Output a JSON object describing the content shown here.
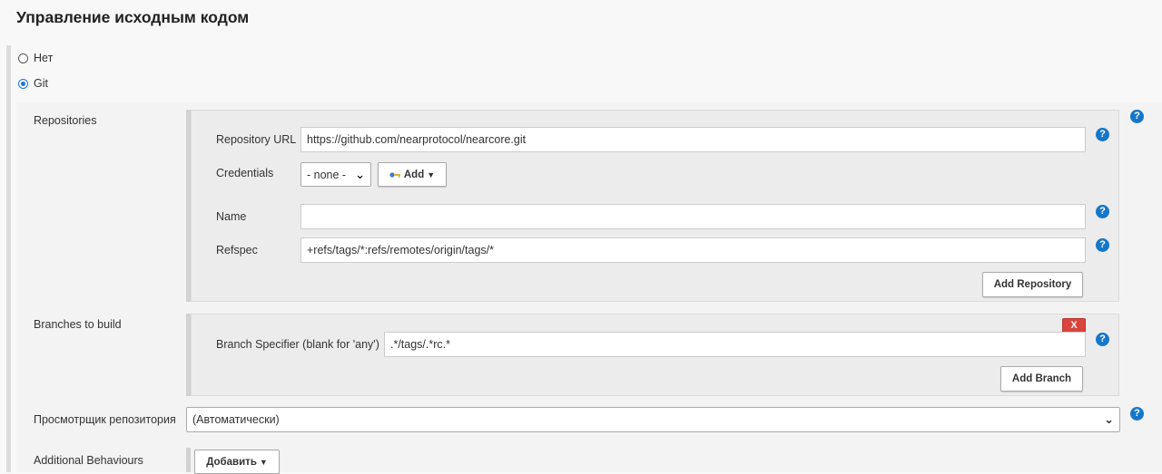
{
  "page": {
    "title": "Управление исходным кодом"
  },
  "scm": {
    "options": [
      {
        "label": "Нет",
        "selected": false
      },
      {
        "label": "Git",
        "selected": true
      }
    ]
  },
  "git": {
    "repositories": {
      "label": "Repositories",
      "url_label": "Repository URL",
      "url_value": "https://github.com/nearprotocol/nearcore.git",
      "credentials_label": "Credentials",
      "credentials_value": "- none -",
      "credentials_add_label": "Add",
      "name_label": "Name",
      "name_value": "",
      "refspec_label": "Refspec",
      "refspec_value": "+refs/tags/*:refs/remotes/origin/tags/*",
      "add_repository_label": "Add Repository"
    },
    "branches": {
      "label": "Branches to build",
      "delete_label": "X",
      "specifier_label": "Branch Specifier (blank for 'any')",
      "specifier_value": ".*/tags/.*rc.*",
      "add_branch_label": "Add Branch"
    },
    "browser": {
      "label": "Просмотрщик репозитория",
      "value": "(Автоматически)"
    },
    "behaviours": {
      "label": "Additional Behaviours",
      "add_label": "Добавить"
    },
    "help_glyph": "?"
  },
  "colors": {
    "help_blue": "#1677c9",
    "delete_red": "#d9443c",
    "radio_selected": "#1a73e8"
  },
  "icons": {
    "help": "question-circle-icon",
    "credentials_add": "key-icon",
    "dropdown": "caret-down-icon",
    "select": "chevron-down-icon"
  }
}
